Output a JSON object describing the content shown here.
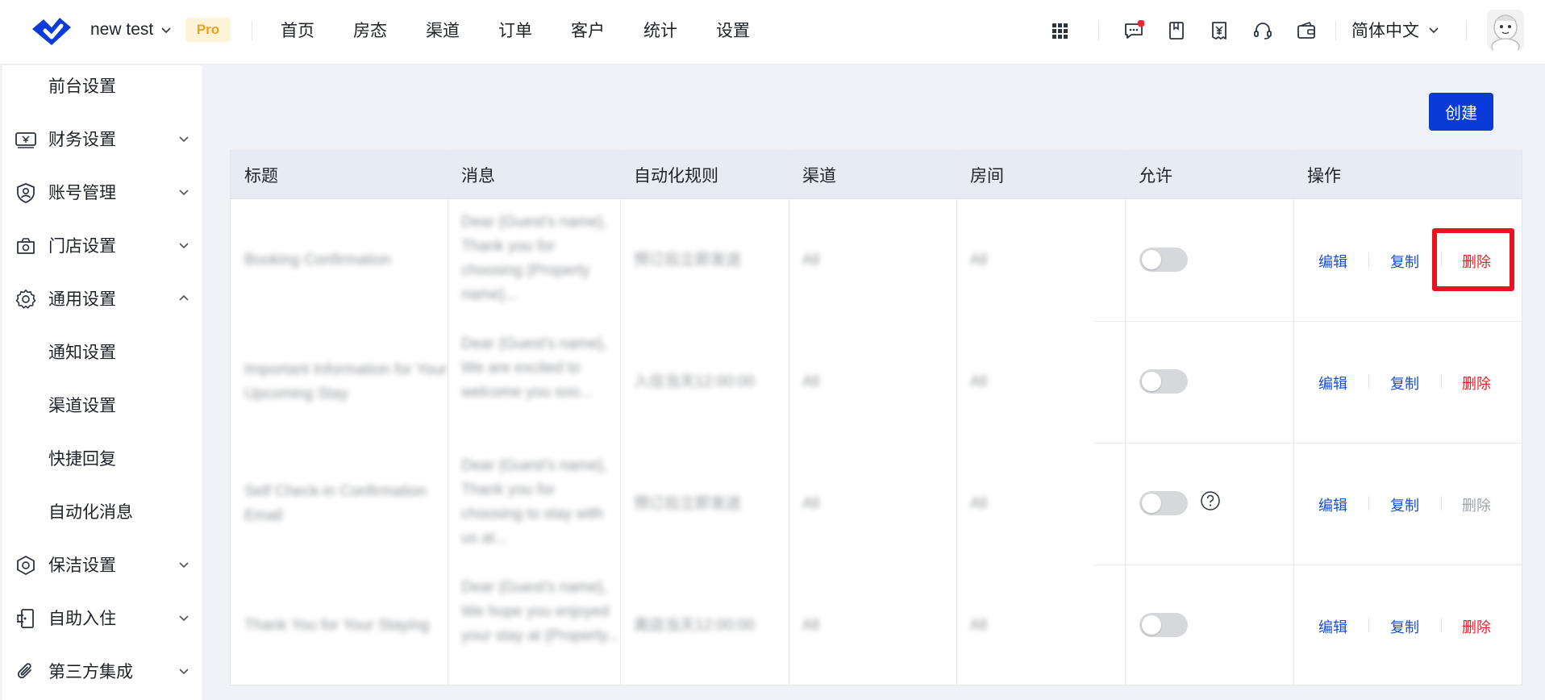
{
  "header": {
    "project_name": "new test",
    "badge": "Pro",
    "nav": [
      "首页",
      "房态",
      "渠道",
      "订单",
      "客户",
      "统计",
      "设置"
    ],
    "icons": [
      "apps-grid-icon",
      "message-icon",
      "book-icon",
      "invoice-icon",
      "headset-icon",
      "wallet-icon"
    ],
    "language": "简体中文",
    "notification_dot_color": "#f5222d"
  },
  "sidebar": {
    "items": [
      {
        "label": "前台设置",
        "icon": null
      },
      {
        "label": "财务设置",
        "icon": "finance-icon",
        "chevron": "down"
      },
      {
        "label": "账号管理",
        "icon": "account-icon",
        "chevron": "down"
      },
      {
        "label": "门店设置",
        "icon": "store-icon",
        "chevron": "down"
      },
      {
        "label": "通用设置",
        "icon": "gear-icon",
        "chevron": "up"
      },
      {
        "label": "通知设置",
        "icon": null
      },
      {
        "label": "渠道设置",
        "icon": null
      },
      {
        "label": "快捷回复",
        "icon": null
      },
      {
        "label": "自动化消息",
        "icon": null
      },
      {
        "label": "保洁设置",
        "icon": "cleaning-icon",
        "chevron": "down"
      },
      {
        "label": "自助入住",
        "icon": "self-checkin-icon",
        "chevron": "down"
      },
      {
        "label": "第三方集成",
        "icon": "paperclip-icon",
        "chevron": "down"
      }
    ]
  },
  "toolbar": {
    "create_label": "创建"
  },
  "table": {
    "headers": [
      "标题",
      "消息",
      "自动化规则",
      "渠道",
      "房间",
      "允许",
      "操作"
    ],
    "rows": [
      {
        "title": "Booking Confirmation",
        "message": "Dear {Guest's name}, Thank you for choosing {Property name}...",
        "rule": "预订后立即发送",
        "channel": "All",
        "room": "All",
        "enabled": false,
        "help": false,
        "actions": {
          "edit": "编辑",
          "copy": "复制",
          "delete": "删除"
        },
        "delete_enabled": true
      },
      {
        "title": "Important Information for Your Upcoming Stay",
        "message": "Dear {Guest's name}, We are excited to welcome you soo...",
        "rule": "入住当天12:00:00",
        "channel": "All",
        "room": "All",
        "enabled": false,
        "help": false,
        "actions": {
          "edit": "编辑",
          "copy": "复制",
          "delete": "删除"
        },
        "delete_enabled": true
      },
      {
        "title": "Self Check-in Confirmation Email",
        "message": "Dear {Guest's name}, Thank you for choosing to stay with us at...",
        "rule": "预订后立即发送",
        "channel": "All",
        "room": "All",
        "enabled": false,
        "help": true,
        "actions": {
          "edit": "编辑",
          "copy": "复制",
          "delete": "删除"
        },
        "delete_enabled": false
      },
      {
        "title": "Thank You for Your Staying",
        "message": "Dear {Guest's name}, We hope you enjoyed your stay at {Property...",
        "rule": "离店当天12:00:00",
        "channel": "All",
        "room": "All",
        "enabled": false,
        "help": false,
        "actions": {
          "edit": "编辑",
          "copy": "复制",
          "delete": "删除"
        },
        "delete_enabled": true
      }
    ]
  },
  "colors": {
    "primary": "#0b3bd6",
    "link_blue": "#1b4fc9",
    "danger_red": "#e5202a",
    "highlight_red": "#e8141f",
    "badge_bg": "#fdf3d6",
    "badge_text": "#f0a01e"
  }
}
